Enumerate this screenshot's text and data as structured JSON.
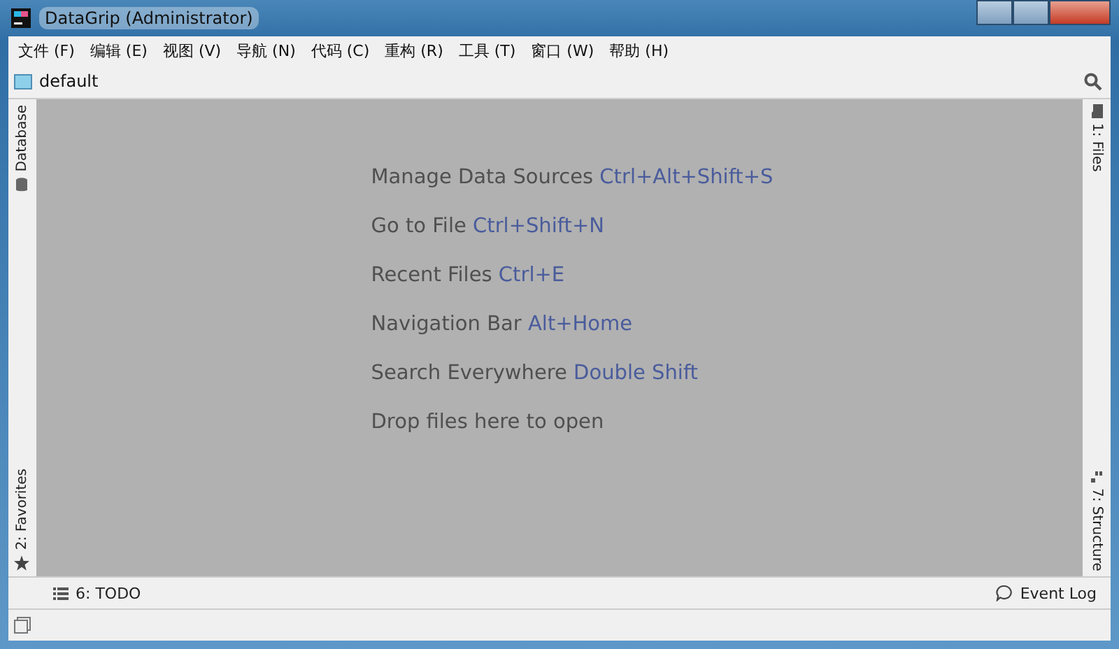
{
  "window": {
    "title": "DataGrip (Administrator)"
  },
  "menu": [
    "文件 (F)",
    "编辑 (E)",
    "视图 (V)",
    "导航 (N)",
    "代码 (C)",
    "重构 (R)",
    "工具 (T)",
    "窗口 (W)",
    "帮助 (H)"
  ],
  "navigation_bar": {
    "item": "default"
  },
  "left_tools": [
    {
      "label": "Database",
      "kind": "database"
    },
    {
      "label": "2: Favorites",
      "kind": "favorites"
    }
  ],
  "right_tools": [
    {
      "label": "1: Files",
      "kind": "files"
    },
    {
      "label": "7: Structure",
      "kind": "structure"
    }
  ],
  "hints": [
    {
      "text": "Manage Data Sources",
      "shortcut": "Ctrl+Alt+Shift+S"
    },
    {
      "text": "Go to File",
      "shortcut": "Ctrl+Shift+N"
    },
    {
      "text": "Recent Files",
      "shortcut": "Ctrl+E"
    },
    {
      "text": "Navigation Bar",
      "shortcut": "Alt+Home"
    },
    {
      "text": "Search Everywhere",
      "shortcut": "Double Shift"
    },
    {
      "text": "Drop files here to open"
    }
  ],
  "bottom_tools": [
    {
      "label": "6: TODO",
      "kind": "todo"
    },
    {
      "label": "Event Log",
      "kind": "event-log"
    }
  ]
}
